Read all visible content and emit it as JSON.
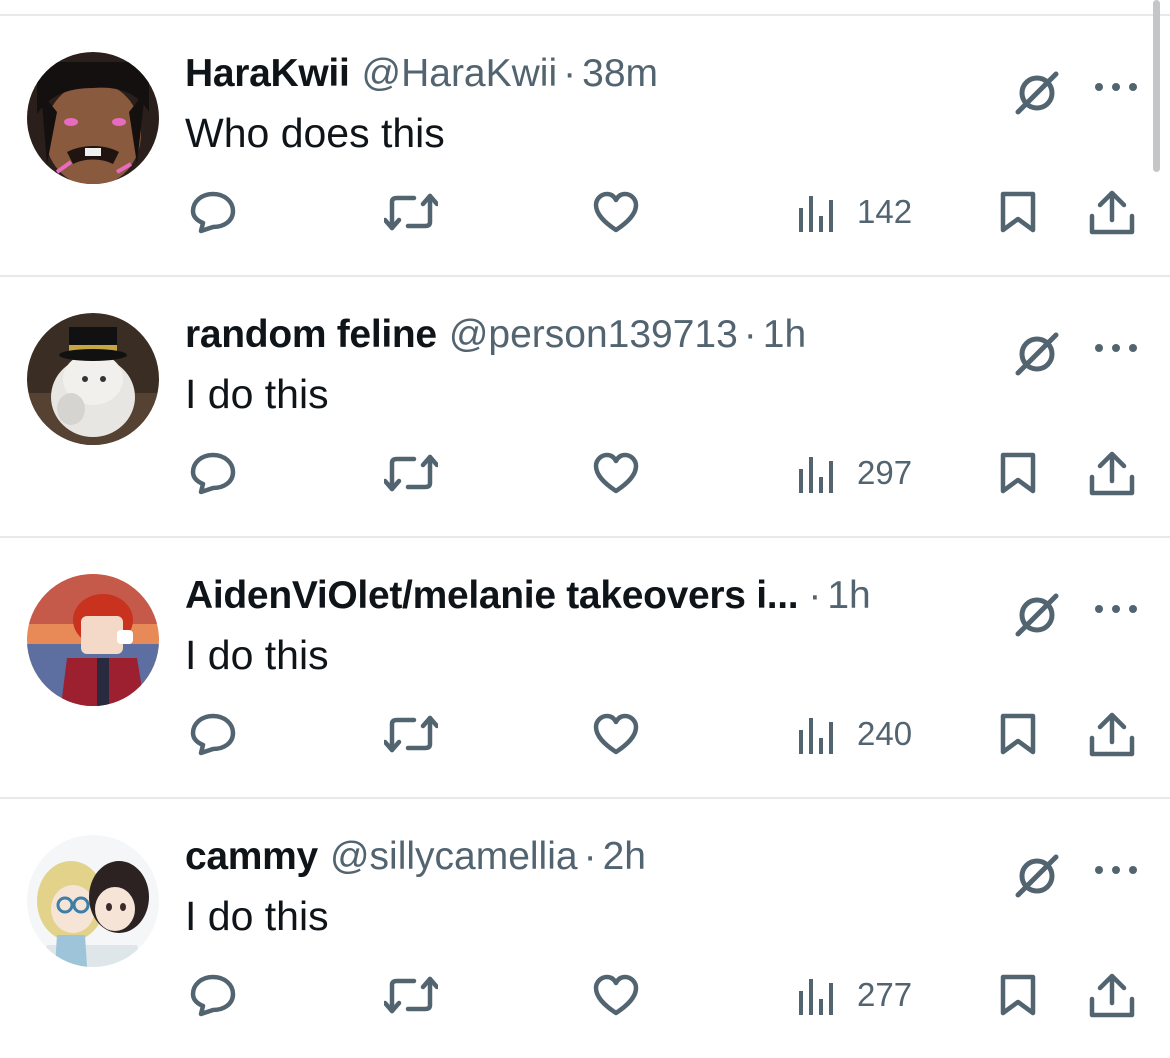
{
  "replies": [
    {
      "display_name": "HaraKwii",
      "handle": "@HaraKwii",
      "separator": "·",
      "time": "38m",
      "text": "Who does this",
      "views": "142",
      "avatar": "avatar-dark-character"
    },
    {
      "display_name": "random feline",
      "handle": "@person139713",
      "separator": "·",
      "time": "1h",
      "text": "I do this",
      "views": "297",
      "avatar": "avatar-cat-top-hat"
    },
    {
      "display_name": "AidenViOlet/melanie takeovers i...",
      "handle": "",
      "separator": "·",
      "time": "1h",
      "text": "I do this",
      "views": "240",
      "avatar": "avatar-sunset-character"
    },
    {
      "display_name": "cammy",
      "handle": "@sillycamellia",
      "separator": "·",
      "time": "2h",
      "text": "I do this",
      "views": "277",
      "avatar": "avatar-two-anime-characters"
    }
  ],
  "icons": {
    "reply": "reply-icon",
    "repost": "repost-icon",
    "like": "heart-icon",
    "views": "views-icon",
    "bookmark": "bookmark-icon",
    "share": "share-icon",
    "grok": "grok-icon",
    "more": "more-icon"
  },
  "colors": {
    "text_primary": "#0f1419",
    "text_secondary": "#536471",
    "divider": "#e7e9ea"
  }
}
